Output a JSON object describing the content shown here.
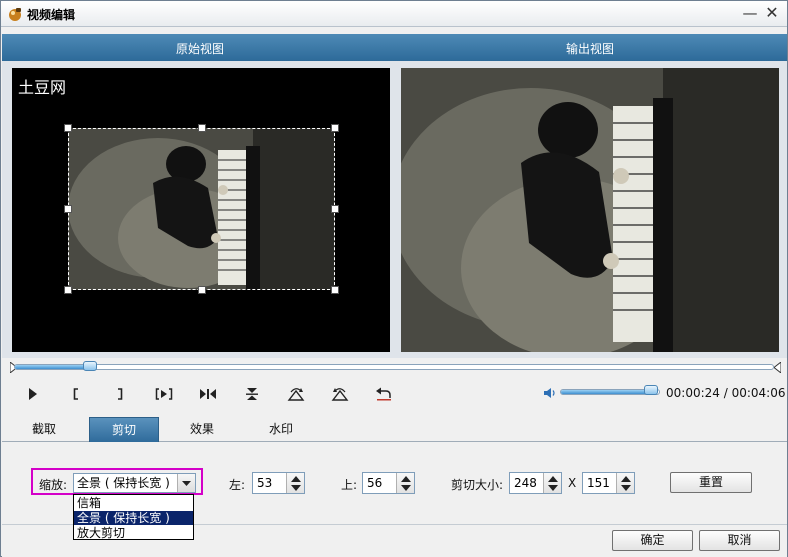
{
  "window": {
    "title": "视频编辑",
    "minimize_glyph": "—",
    "close_glyph": "✕"
  },
  "views": {
    "source_label": "原始视图",
    "output_label": "输出视图",
    "watermark_text": "土豆网"
  },
  "playback": {
    "seek_position_fraction": 0.1,
    "volume_fraction": 0.93,
    "current_time": "00:00:24",
    "total_time": "00:04:06",
    "time_separator": " / ",
    "buttons": [
      {
        "name": "play-icon",
        "glyph": "play"
      },
      {
        "name": "mark-in-icon",
        "glyph": "["
      },
      {
        "name": "mark-out-icon",
        "glyph": "]"
      },
      {
        "name": "play-selection-icon",
        "glyph": "[▶]"
      },
      {
        "name": "step-icon",
        "glyph": "▶|◀"
      },
      {
        "name": "flip-vertical-icon",
        "glyph": "flipv"
      },
      {
        "name": "rotate-right-icon",
        "glyph": "rotr"
      },
      {
        "name": "rotate-left-icon",
        "glyph": "rotl"
      },
      {
        "name": "undo-icon",
        "glyph": "undo"
      }
    ]
  },
  "tabs": [
    {
      "label": "截取",
      "active": false
    },
    {
      "label": "剪切",
      "active": true
    },
    {
      "label": "效果",
      "active": false
    },
    {
      "label": "水印",
      "active": false
    }
  ],
  "crop": {
    "zoom_label": "缩放:",
    "zoom_selected": "全景 ( 保持长宽 )",
    "zoom_options": [
      "信箱",
      "全景 ( 保持长宽 )",
      "放大剪切"
    ],
    "left_label": "左:",
    "left_value": "53",
    "top_label": "上:",
    "top_value": "56",
    "size_label": "剪切大小:",
    "width_value": "248",
    "times": "X",
    "height_value": "151",
    "reset_label": "重置"
  },
  "footer": {
    "ok_label": "确定",
    "cancel_label": "取消"
  },
  "colors": {
    "header_band": "#3a78a8",
    "active_tab": "#3a78a8",
    "highlight_border": "#d400c8",
    "dropdown_selected": "#0a246a"
  }
}
